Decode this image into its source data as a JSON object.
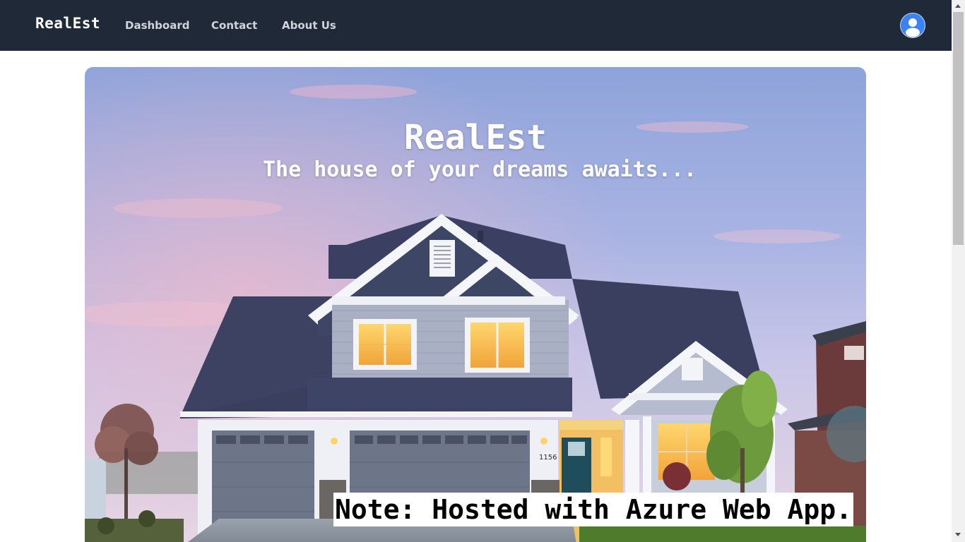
{
  "navbar": {
    "brand": "RealEst",
    "links": [
      {
        "label": "Dashboard"
      },
      {
        "label": "Contact"
      },
      {
        "label": "About Us"
      }
    ],
    "avatar_icon": "user-avatar-icon",
    "background": "#1f2937"
  },
  "hero": {
    "title": "RealEst",
    "subtitle": "The house of your dreams awaits...",
    "image_icon": "house-photo",
    "house_number": "1156"
  },
  "note": {
    "text": "Note: Hosted with Azure Web App."
  }
}
